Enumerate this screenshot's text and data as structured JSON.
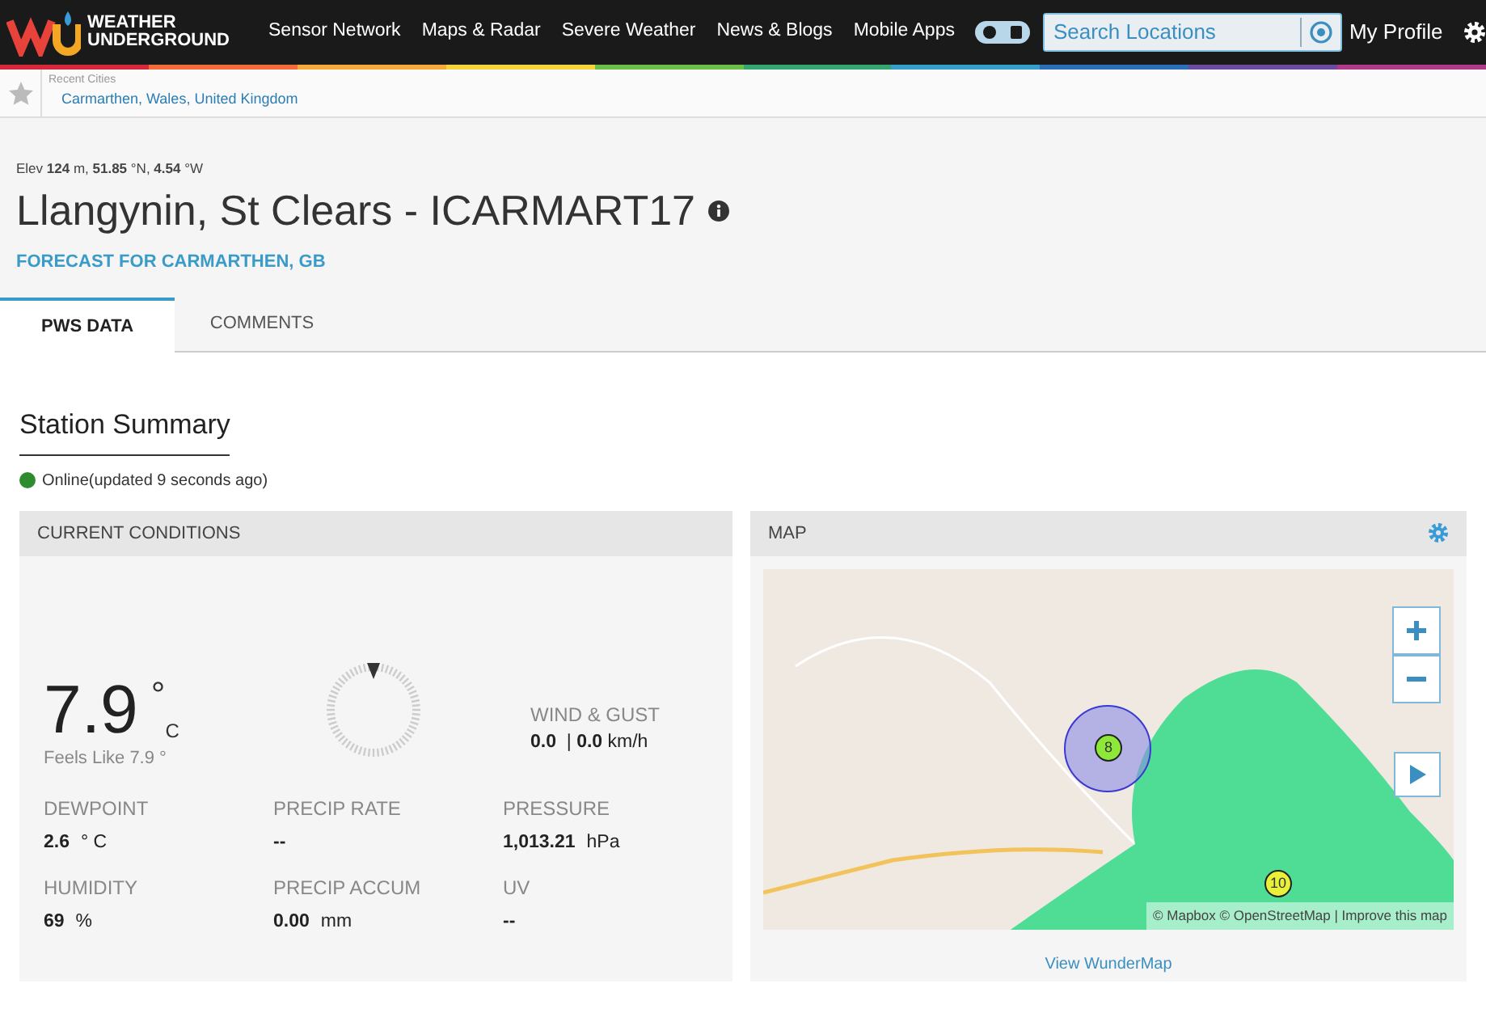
{
  "navbar": {
    "logo_text": [
      "WEATHER",
      "UNDERGROUND"
    ],
    "links": [
      "Sensor Network",
      "Maps & Radar",
      "Severe Weather",
      "News & Blogs",
      "Mobile Apps"
    ],
    "search": {
      "placeholder": "Search Locations"
    },
    "profile": "My Profile"
  },
  "recent_cities": {
    "label": "Recent Cities",
    "cities": [
      "Carmarthen, Wales, United Kingdom"
    ]
  },
  "station": {
    "elevation": "Elev **124** m, **51.85** °N, **4.54** °W",
    "title": "Llangynin, St Clears - ICARMART17",
    "forecast_link": "FORECAST FOR CARMARTHEN, GB"
  },
  "tabs": [
    {
      "label": "PWS DATA",
      "selected": true
    },
    {
      "label": "COMMENTS",
      "selected": false
    }
  ],
  "summary": {
    "heading": "Station Summary",
    "status": {
      "text": "Online(updated 9 seconds ago)",
      "online": true
    }
  },
  "current_conditions": {
    "header": "CURRENT CONDITIONS",
    "temperature": "7.9",
    "degree": "°",
    "unit": "C",
    "feels_like": "Feels Like 7.9 °",
    "wind": {
      "label": "WIND & GUST",
      "value": "**0.0**  | **0.0** km/h"
    },
    "stats": [
      {
        "label": "DEWPOINT",
        "value": "2.6",
        "unit": "° C"
      },
      {
        "label": "PRECIP RATE",
        "value": "--"
      },
      {
        "label": "PRESSURE",
        "value": "1,013.21",
        "unit": "hPa"
      },
      {
        "label": "HUMIDITY",
        "value": "69",
        "unit": "%"
      },
      {
        "label": "PRECIP ACCUM",
        "value": "0.00",
        "unit": "mm"
      },
      {
        "label": "UV",
        "value": "--"
      }
    ]
  },
  "map": {
    "header": "MAP",
    "markers": [
      {
        "label": "8"
      },
      {
        "label": "10"
      }
    ],
    "attribution": "© Mapbox © OpenStreetMap | Improve this map",
    "link": "View WunderMap"
  }
}
